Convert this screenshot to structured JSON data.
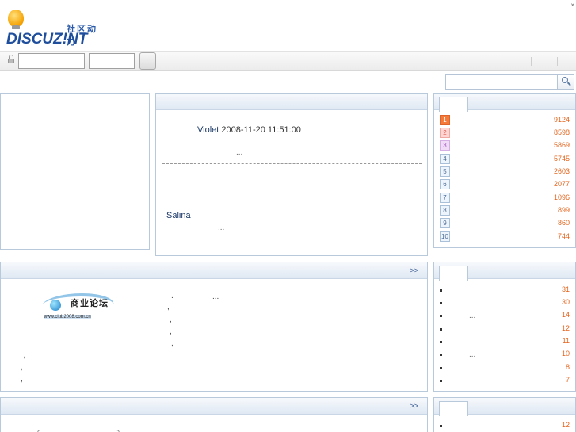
{
  "logo": {
    "cn": "社区动力",
    "text": "DISCUZ!NT"
  },
  "corner_mark": "×",
  "login": {
    "username_value": "",
    "password_value": ""
  },
  "search": {
    "value": ""
  },
  "latest": {
    "post1_author": "Violet",
    "post1_time": "2008-11-20 11:51:00",
    "ellipsis": "...",
    "post2_author": "Salina"
  },
  "hot": {
    "more": ">>",
    "ellipsis": "...",
    "comma": ",",
    "dot": "."
  },
  "banner": {
    "cn": "商业论坛",
    "url": "www.club2008.com.cn"
  },
  "ranking": [
    {
      "rank": "1",
      "value": "9124"
    },
    {
      "rank": "2",
      "value": "8598"
    },
    {
      "rank": "3",
      "value": "5869"
    },
    {
      "rank": "4",
      "value": "5745"
    },
    {
      "rank": "5",
      "value": "2603"
    },
    {
      "rank": "6",
      "value": "2077"
    },
    {
      "rank": "7",
      "value": "1096"
    },
    {
      "rank": "8",
      "value": "899"
    },
    {
      "rank": "9",
      "value": "860"
    },
    {
      "rank": "10",
      "value": "744"
    }
  ],
  "list2": [
    "31",
    "30",
    "14",
    "12",
    "11",
    "10",
    "8",
    "7"
  ],
  "list2_ellipsis": "...",
  "bottom": {
    "more": ">>",
    "first_value": "12"
  }
}
